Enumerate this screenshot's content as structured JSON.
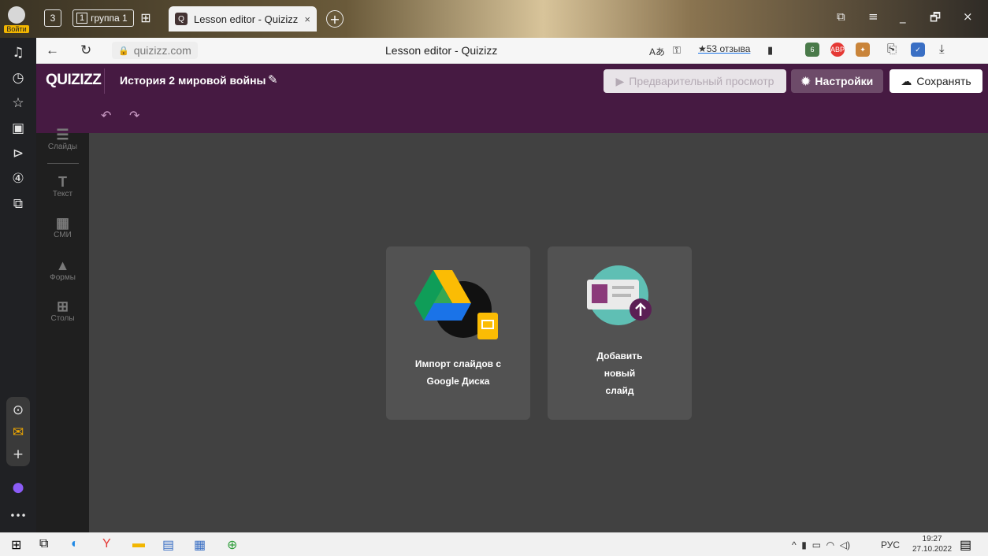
{
  "browser": {
    "login_label": "Войти",
    "tab_counter": "3",
    "tab_group": {
      "count": "1",
      "label": "группа 1"
    },
    "active_tab": {
      "title": "Lesson editor - Quizizz",
      "close": "×"
    },
    "new_tab": "+",
    "url": "quizizz.com",
    "page_title": "Lesson editor - Quizizz",
    "reviews": "★53 отзыва",
    "ext_badge_count": "6",
    "ext_abp": "ABP",
    "window_controls": [
      "⧉",
      "≡",
      "_",
      "🗗",
      "×"
    ]
  },
  "header": {
    "logo": "QUIZIZZ",
    "lesson_title": "История 2 мировой войны",
    "preview_label": "Предварительный просмотр",
    "settings_label": "Настройки",
    "save_label": "Сохранять"
  },
  "toolbar": {
    "slides": "Слайды",
    "text": "Текст",
    "media": "СМИ",
    "shapes": "Формы",
    "tables": "Столы"
  },
  "cards": {
    "import": {
      "line1": "Импорт слайдов с",
      "line2": "Google Диска"
    },
    "new_slide": {
      "line1": "Добавить",
      "line2": "новый",
      "line3": "слайд"
    }
  },
  "taskbar": {
    "lang": "РУС",
    "time": "19:27",
    "date": "27.10.2022"
  },
  "colors": {
    "header_bg": "#461a42",
    "editor_bg": "#414141",
    "card_bg": "#525252",
    "settings_btn": "#6d4b69"
  }
}
